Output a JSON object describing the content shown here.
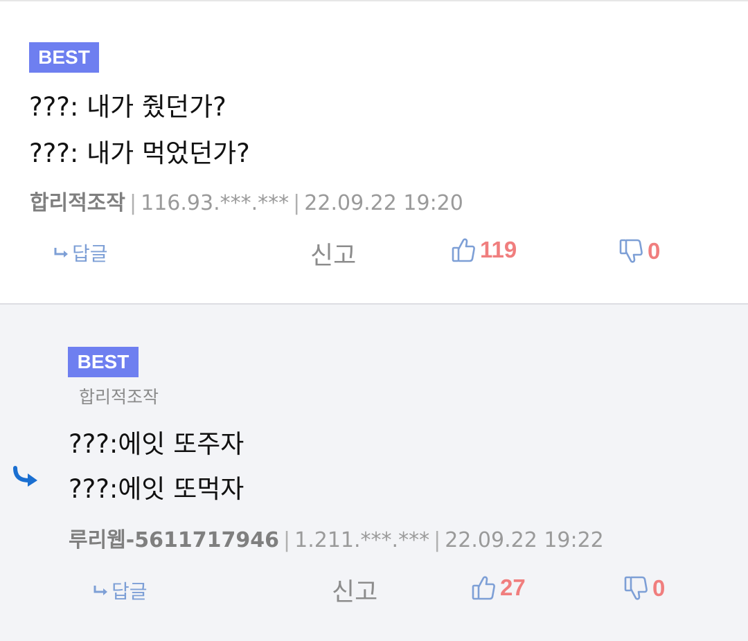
{
  "comments": [
    {
      "badge": "BEST",
      "lines": [
        "???: 내가 줬던가?",
        "???: 내가 먹었던가?"
      ],
      "author": "합리적조작",
      "ip": "116.93.***.***",
      "datetime": "22.09.22 19:20",
      "reply_label": "답글",
      "report_label": "신고",
      "likes": "119",
      "dislikes": "0"
    },
    {
      "badge": "BEST",
      "parent_author": "합리적조작",
      "lines": [
        "???:에잇 또주자",
        "???:에잇 또먹자"
      ],
      "author": "루리웹-5611717946",
      "ip": "1.211.***.***",
      "datetime": "22.09.22 19:22",
      "reply_label": "답글",
      "report_label": "신고",
      "likes": "27",
      "dislikes": "0"
    }
  ],
  "colors": {
    "badge": "#6e7ff0",
    "accent_blue": "#7d9fd6",
    "count_red": "#f07e7e",
    "reply_arrow": "#1a6fd1"
  },
  "icons": [
    "reply-arrow-icon",
    "thumbs-up-icon",
    "thumbs-down-icon"
  ]
}
